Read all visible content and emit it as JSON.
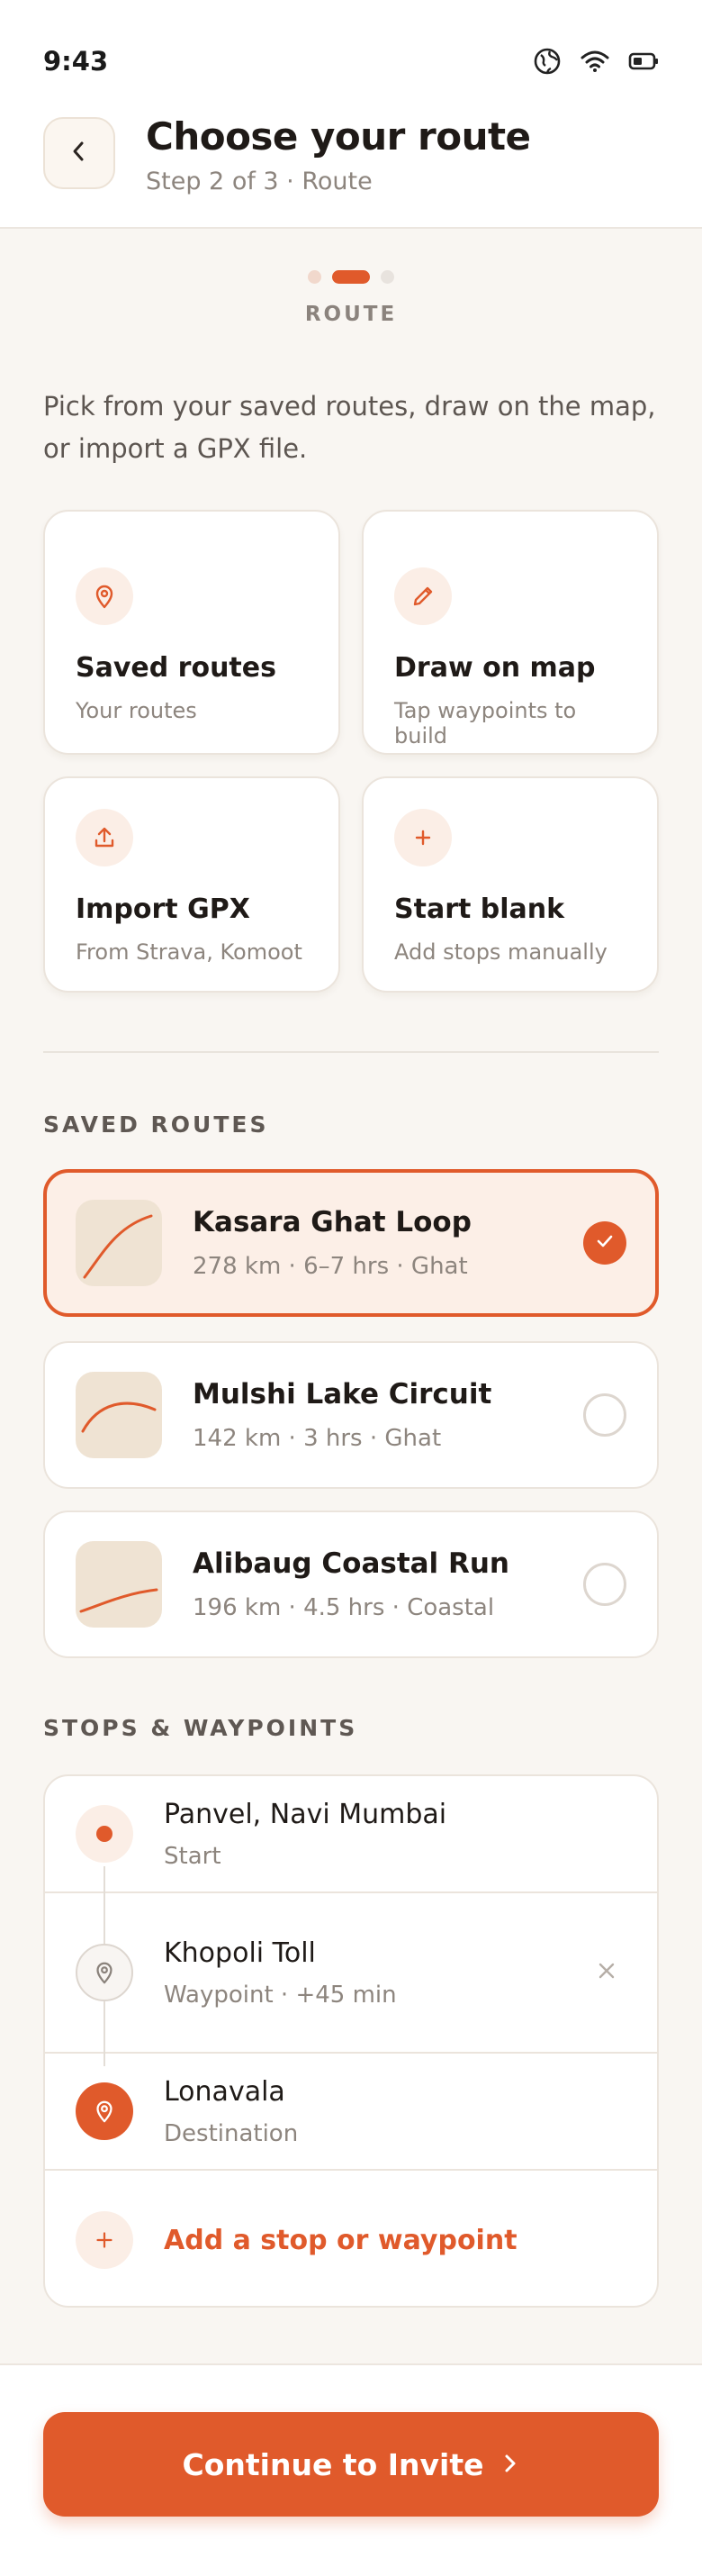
{
  "status_bar": {
    "time": "9:43",
    "icons": [
      "globe-icon",
      "wifi-icon",
      "battery-icon"
    ]
  },
  "header": {
    "back_icon": "chevron-left-icon",
    "title": "Choose your route",
    "subtitle": "Step 2 of 3 · Route"
  },
  "stepper": {
    "total_steps": 3,
    "current_step": 2,
    "label": "ROUTE"
  },
  "intro": "Pick from your saved routes, draw on the map, or import a GPX file.",
  "options": [
    {
      "icon": "map-pin-icon",
      "title": "Saved routes",
      "desc": "Your routes"
    },
    {
      "icon": "pencil-icon",
      "title": "Draw on map",
      "desc": "Tap waypoints to build"
    },
    {
      "icon": "upload-icon",
      "title": "Import GPX",
      "desc": "From Strava, Komoot"
    },
    {
      "icon": "plus-icon",
      "title": "Start blank",
      "desc": "Add stops manually"
    }
  ],
  "saved_routes": {
    "heading": "SAVED ROUTES",
    "items": [
      {
        "name": "Kasara Ghat Loop",
        "meta": "278 km · 6–7 hrs · Ghat",
        "selected": true
      },
      {
        "name": "Mulshi Lake Circuit",
        "meta": "142 km · 3 hrs · Ghat",
        "selected": false
      },
      {
        "name": "Alibaug Coastal Run",
        "meta": "196 km · 4.5 hrs · Coastal",
        "selected": false
      }
    ]
  },
  "stops": {
    "heading": "STOPS & WAYPOINTS",
    "items": [
      {
        "name": "Panvel, Navi Mumbai",
        "sub": "Start",
        "kind": "start"
      },
      {
        "name": "Khopoli Toll",
        "sub": "Waypoint · +45 min",
        "kind": "waypoint",
        "removable": true
      },
      {
        "name": "Lonavala",
        "sub": "Destination",
        "kind": "destination"
      }
    ],
    "add_label": "Add a stop or waypoint"
  },
  "cta": {
    "label": "Continue to Invite",
    "icon": "chevron-right-icon"
  },
  "colors": {
    "accent": "#e05a2b",
    "accent_soft": "#fbeee6",
    "background": "#f9f6f2",
    "thumb_bg": "#efe3d3"
  }
}
